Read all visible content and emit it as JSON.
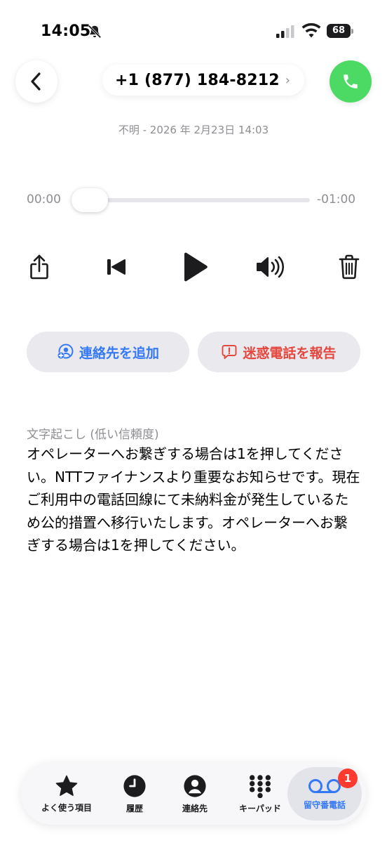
{
  "status_bar": {
    "time": "14:05",
    "battery": "68",
    "icons": [
      "bell-slash-icon",
      "cellular-signal-icon",
      "wifi-icon",
      "battery-icon"
    ]
  },
  "header": {
    "phone_number": "+1 (877) 184-8212",
    "chevron": "›",
    "meta": "不明 - 2026 年 2月23日 14:03",
    "icons": [
      "back-chevron-icon",
      "phone-icon"
    ]
  },
  "player": {
    "elapsed": "00:00",
    "remaining": "-01:00",
    "progress": 0,
    "icons": [
      "share-icon",
      "skip-back-icon",
      "play-icon",
      "speaker-icon",
      "trash-icon"
    ]
  },
  "actions": {
    "add_contact": "連絡先を追加",
    "report_spam": "迷惑電話を報告",
    "icons": [
      "add-contact-icon",
      "report-icon"
    ]
  },
  "transcript": {
    "label": "文字起こし (低い信頼度)",
    "text": "オペレーターへお繋ぎする場合は1を押してください。NTTファイナンスより重要なお知らせです。現在ご利用中の電話回線にて未納料金が発生しているため公的措置へ移行いたします。オペレーターへお繋ぎする場合は1を押してください。"
  },
  "tabbar": {
    "items": [
      {
        "label": "よく使う項目",
        "icon": "star-icon"
      },
      {
        "label": "履歴",
        "icon": "clock-icon"
      },
      {
        "label": "連絡先",
        "icon": "person-icon"
      },
      {
        "label": "キーパッド",
        "icon": "keypad-icon"
      },
      {
        "label": "留守番電話",
        "icon": "voicemail-icon"
      }
    ],
    "active_index": 4,
    "voicemail_badge": "1"
  },
  "colors": {
    "accent": "#3478f6",
    "call_green": "#4cd964",
    "danger": "#e5473e",
    "badge": "#ff3b30",
    "secondary_text": "#8e8e93"
  }
}
